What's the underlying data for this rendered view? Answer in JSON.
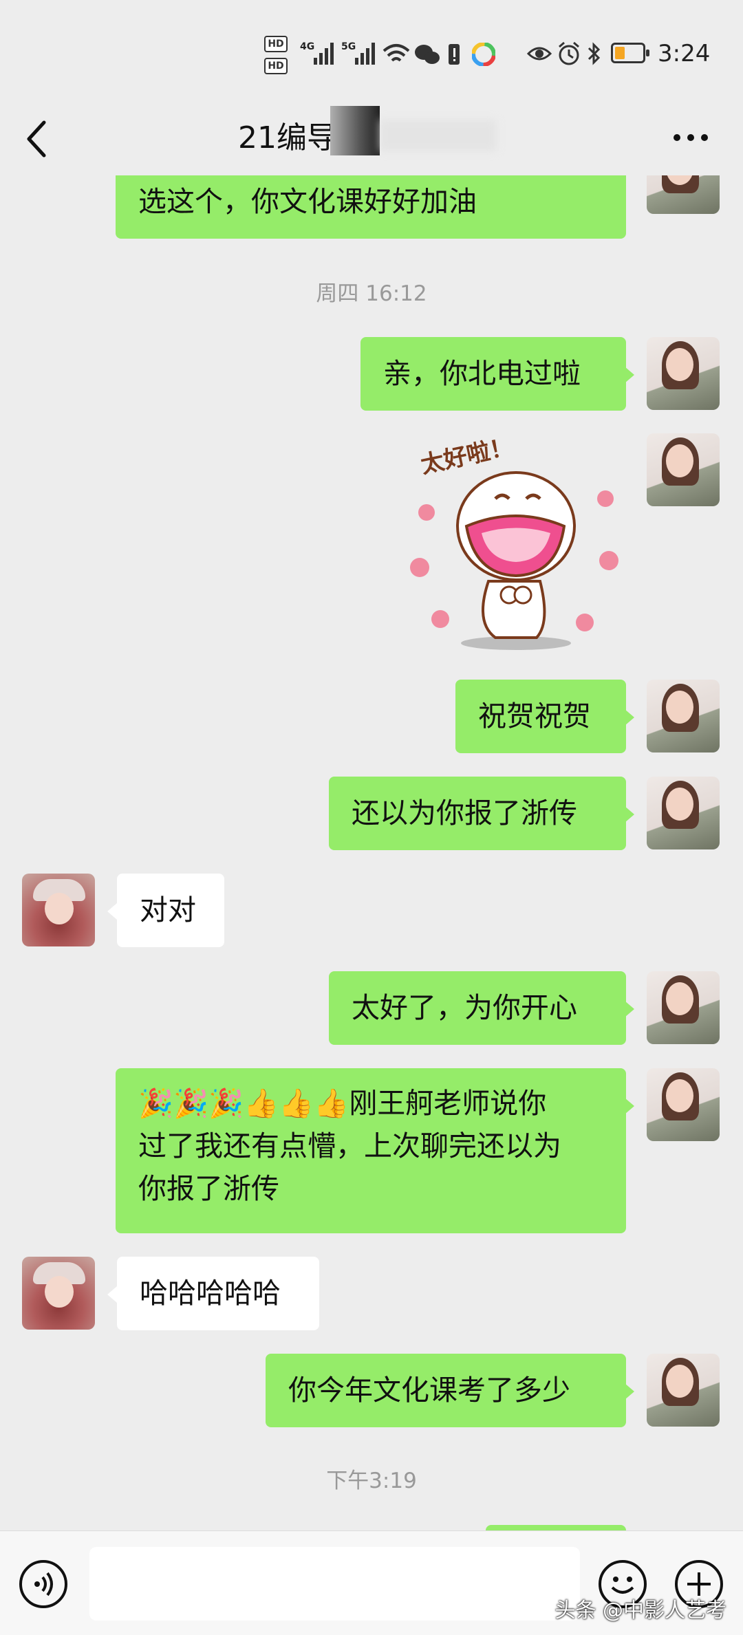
{
  "status_bar": {
    "hd1": "HD",
    "hd2": "HD",
    "net1": "4G",
    "net2": "5G",
    "time": "3:24",
    "battery_color": "#f5a623"
  },
  "header": {
    "title": "21编导",
    "back_icon": "chevron-left-icon",
    "more_icon": "more-icon"
  },
  "messages": [
    {
      "side": "right",
      "text": "选这个，你文化课好好加油"
    },
    {
      "type": "time",
      "text": "周四 16:12"
    },
    {
      "side": "right",
      "text": "亲，你北电过啦"
    },
    {
      "side": "right",
      "type": "sticker",
      "text": "太好啦！"
    },
    {
      "side": "right",
      "text": "祝贺祝贺"
    },
    {
      "side": "right",
      "text": "还以为你报了浙传"
    },
    {
      "side": "left",
      "text": "对对"
    },
    {
      "side": "right",
      "text": "太好了，为你开心"
    },
    {
      "side": "right",
      "emoji": "🎉🎉🎉👍👍👍",
      "line1": "刚王舸老师说你",
      "line2": "过了我还有点懵，上次聊完还以为",
      "line3": "你报了浙传"
    },
    {
      "side": "left",
      "text": "哈哈哈哈哈"
    },
    {
      "side": "right",
      "text": "你今年文化课考了多少"
    },
    {
      "type": "time",
      "text": "下午3:19"
    }
  ],
  "input_bar": {
    "voice_icon": "voice-icon",
    "emoji_icon": "emoji-icon",
    "plus_icon": "plus-icon"
  },
  "watermark": "头条 @中影人艺考",
  "colors": {
    "my_bubble": "#95ec69",
    "other_bubble": "#ffffff",
    "background": "#ededed"
  }
}
